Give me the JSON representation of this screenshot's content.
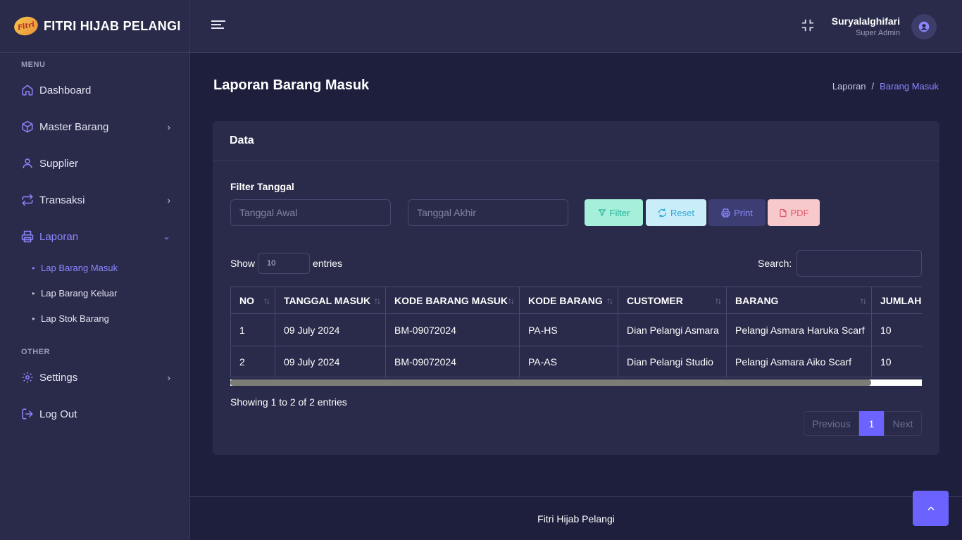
{
  "brand": {
    "name": "FITRI HIJAB PELANGI",
    "logo_text": "Fitri"
  },
  "sidebar": {
    "menu_heading": "MENU",
    "other_heading": "OTHER",
    "items": [
      {
        "label": "Dashboard"
      },
      {
        "label": "Master Barang"
      },
      {
        "label": "Supplier"
      },
      {
        "label": "Transaksi"
      },
      {
        "label": "Laporan"
      }
    ],
    "sub_items": [
      {
        "label": "Lap Barang Masuk"
      },
      {
        "label": "Lap Barang Keluar"
      },
      {
        "label": "Lap Stok Barang"
      }
    ],
    "other_items": [
      {
        "label": "Settings"
      },
      {
        "label": "Log Out"
      }
    ]
  },
  "topbar": {
    "user_name": "Suryalalghifari",
    "user_role": "Super Admin"
  },
  "page": {
    "title": "Laporan Barang Masuk",
    "breadcrumb": [
      "Laporan",
      "/",
      "Barang Masuk"
    ]
  },
  "card": {
    "title": "Data",
    "filter_label": "Filter Tanggal",
    "start_placeholder": "Tanggal Awal",
    "end_placeholder": "Tanggal Akhir",
    "buttons": {
      "filter": "Filter",
      "reset": "Reset",
      "print": "Print",
      "pdf": "PDF"
    },
    "show_label": "Show",
    "entries_value": "10",
    "entries_label": "entries",
    "search_label": "Search:",
    "search_value": ""
  },
  "table": {
    "headers": [
      "NO",
      "TANGGAL MASUK",
      "KODE BARANG MASUK",
      "KODE BARANG",
      "CUSTOMER",
      "BARANG",
      "JUMLAH"
    ],
    "rows": [
      [
        "1",
        "09 July 2024",
        "BM-09072024",
        "PA-HS",
        "Dian Pelangi Asmara",
        "Pelangi Asmara Haruka Scarf",
        "10"
      ],
      [
        "2",
        "09 July 2024",
        "BM-09072024",
        "PA-AS",
        "Dian Pelangi Studio",
        "Pelangi Asmara Aiko Scarf",
        "10"
      ]
    ]
  },
  "pagination": {
    "info": "Showing 1 to 2 of 2 entries",
    "previous": "Previous",
    "current": "1",
    "next": "Next"
  },
  "footer": {
    "text": "Fitri Hijab Pelangi"
  },
  "colors": {
    "accent": "#6c63ff",
    "background": "#1e1f3d",
    "panel": "#2a2b4a"
  }
}
